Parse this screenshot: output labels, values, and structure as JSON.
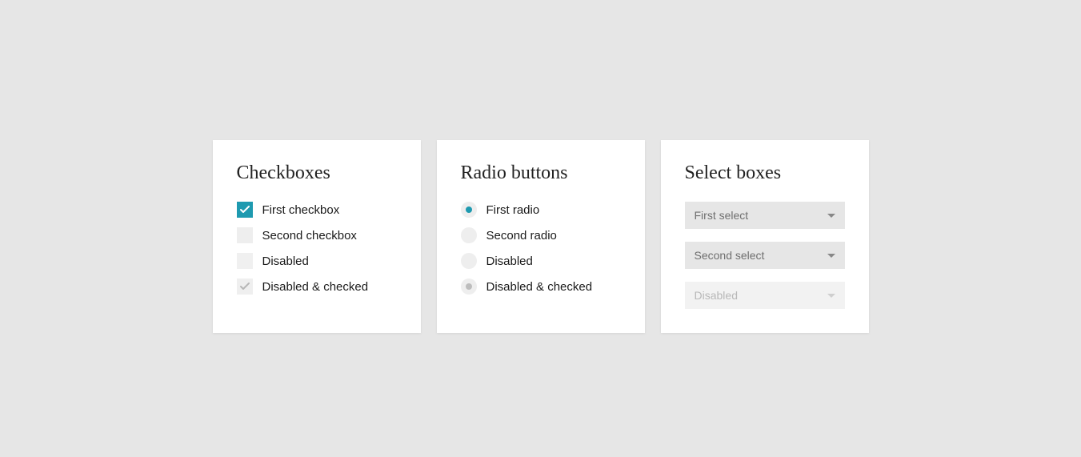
{
  "colors": {
    "accent": "#1e9ab0",
    "background": "#e6e6e6",
    "card": "#ffffff"
  },
  "checkboxes": {
    "title": "Checkboxes",
    "items": [
      {
        "label": "First checkbox",
        "checked": true,
        "disabled": false
      },
      {
        "label": "Second checkbox",
        "checked": false,
        "disabled": false
      },
      {
        "label": "Disabled",
        "checked": false,
        "disabled": true
      },
      {
        "label": "Disabled & checked",
        "checked": true,
        "disabled": true
      }
    ]
  },
  "radios": {
    "title": "Radio buttons",
    "items": [
      {
        "label": "First radio",
        "checked": true,
        "disabled": false
      },
      {
        "label": "Second radio",
        "checked": false,
        "disabled": false
      },
      {
        "label": "Disabled",
        "checked": false,
        "disabled": true
      },
      {
        "label": "Disabled & checked",
        "checked": true,
        "disabled": true
      }
    ]
  },
  "selects": {
    "title": "Select boxes",
    "items": [
      {
        "label": "First select",
        "disabled": false
      },
      {
        "label": "Second select",
        "disabled": false
      },
      {
        "label": "Disabled",
        "disabled": true
      }
    ]
  }
}
